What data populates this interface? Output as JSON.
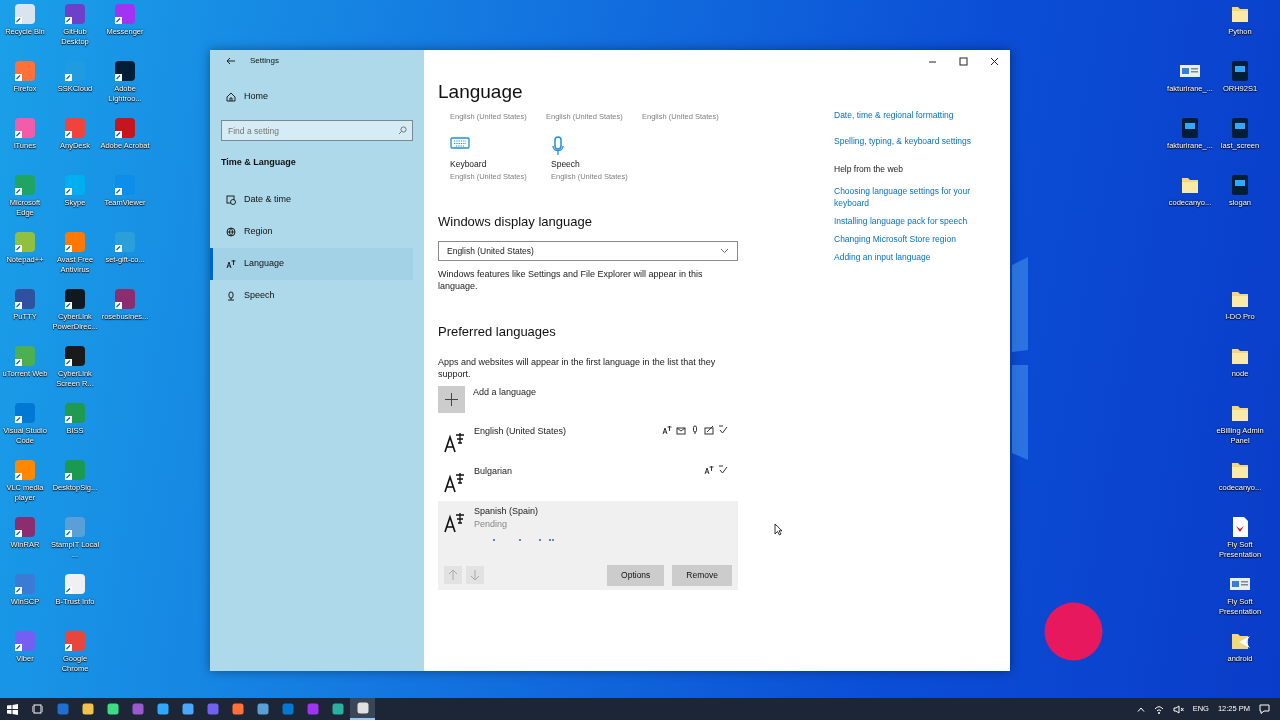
{
  "desktop": {
    "left_columns": [
      [
        {
          "label": "Recycle Bin",
          "color": "#d9e4ee"
        },
        {
          "label": "Firefox",
          "color": "#ff7139"
        },
        {
          "label": "iTunes",
          "color": "#f25ca8"
        },
        {
          "label": "Microsoft Edge",
          "color": "#1fa463"
        },
        {
          "label": "Notepad++",
          "color": "#90c040"
        },
        {
          "label": "PuTTY",
          "color": "#3050a0"
        },
        {
          "label": "uTorrent Web",
          "color": "#4caf50"
        },
        {
          "label": "Visual Studio Code",
          "color": "#0078d4"
        },
        {
          "label": "VLC media player",
          "color": "#ff8800"
        },
        {
          "label": "WinRAR",
          "color": "#8b2d6e"
        },
        {
          "label": "WinSCP",
          "color": "#3a7bd5"
        },
        {
          "label": "Viber",
          "color": "#7360f2"
        }
      ],
      [
        {
          "label": "GitHub Desktop",
          "color": "#6e40c9"
        },
        {
          "label": "SSKCloud",
          "color": "#1f9be0"
        },
        {
          "label": "AnyDesk",
          "color": "#ef443b"
        },
        {
          "label": "Skype",
          "color": "#00aff0"
        },
        {
          "label": "Avast Free Antivirus",
          "color": "#ff7800"
        },
        {
          "label": "CyberLink PowerDirec...",
          "color": "#101820"
        },
        {
          "label": "CyberLink Screen R...",
          "color": "#1a1a1a"
        },
        {
          "label": "BISS",
          "color": "#1f9a4f"
        },
        {
          "label": "DesktopSig...",
          "color": "#1a9a50"
        },
        {
          "label": "StampIT Local ...",
          "color": "#5aa0d8"
        },
        {
          "label": "B-Trust Info",
          "color": "#f0f0f0"
        },
        {
          "label": "Google Chrome",
          "color": "#e8453c"
        }
      ],
      [
        {
          "label": "Messenger",
          "color": "#a034f0"
        },
        {
          "label": "Adobe Lightroo...",
          "color": "#001e36"
        },
        {
          "label": "Adobe Acrobat",
          "color": "#c4161c"
        },
        {
          "label": "TeamViewer",
          "color": "#0e8ee9"
        },
        {
          "label": "set-gift-co...",
          "color": "#2a9fd8"
        },
        {
          "label": "rosebusines...",
          "color": "#8b2d6e"
        }
      ]
    ],
    "right_inner": [
      {
        "label": "fakturirane_...",
        "kind": "document"
      },
      {
        "label": "fakturirane_...",
        "kind": "psd"
      },
      {
        "label": "codecanyo...",
        "kind": "folder"
      }
    ],
    "right_top": [
      {
        "label": "Python",
        "kind": "folder"
      },
      {
        "label": "ORH92S1",
        "kind": "psd"
      },
      {
        "label": "last_screen",
        "kind": "psd"
      },
      {
        "label": "slogan",
        "kind": "psd"
      }
    ],
    "right_bottom": [
      {
        "label": "I-DO Pro",
        "kind": "folder"
      },
      {
        "label": "node",
        "kind": "folder"
      },
      {
        "label": "eBilling Admin Panel",
        "kind": "folder"
      },
      {
        "label": "codecanyo...",
        "kind": "folder"
      },
      {
        "label": "Fly Soft Presentation",
        "kind": "pdf"
      },
      {
        "label": "Fly Soft Presentation",
        "kind": "document"
      },
      {
        "label": "android",
        "kind": "shortcut"
      }
    ]
  },
  "window": {
    "title": "Settings",
    "sidebar": {
      "home": "Home",
      "search": {
        "placeholder": "Find a setting"
      },
      "section": "Time & Language",
      "items": [
        {
          "label": "Date & time",
          "selected": false,
          "kind": "clock"
        },
        {
          "label": "Region",
          "selected": false,
          "kind": "globe"
        },
        {
          "label": "Language",
          "selected": true,
          "kind": "language"
        },
        {
          "label": "Speech",
          "selected": false,
          "kind": "mic"
        }
      ]
    },
    "page_title": "Language",
    "tiles_top": [
      "English (United States)",
      "English (United States)",
      "English (United States)"
    ],
    "tiles": [
      {
        "label": "Keyboard",
        "value": "English (United States)",
        "kind": "keyboard"
      },
      {
        "label": "Speech",
        "value": "English (United States)",
        "kind": "mic"
      }
    ],
    "display_language": {
      "heading": "Windows display language",
      "value": "English (United States)",
      "note": "Windows features like Settings and File Explorer will appear in this language."
    },
    "preferred": {
      "heading": "Preferred languages",
      "note": "Apps and websites will appear in the first language in the list that they support.",
      "add": "Add a language",
      "languages": [
        {
          "name": "English (United States)",
          "selected": false,
          "features": {
            "display": true,
            "keyboard": true,
            "speech": true,
            "handwriting": true,
            "spelling": true
          }
        },
        {
          "name": "Bulgarian",
          "selected": false,
          "features": {
            "display": true,
            "spelling": true
          }
        },
        {
          "name": "Spanish (Spain)",
          "selected": true,
          "status": "Pending"
        }
      ],
      "buttons": [
        {
          "label": "Options"
        },
        {
          "label": "Remove"
        }
      ]
    },
    "related": [
      "Date, time & regional formatting",
      "Spelling, typing, & keyboard settings"
    ],
    "help": {
      "heading": "Help from the web",
      "links": [
        "Choosing language settings for your keyboard",
        "Installing language pack for speech",
        "Changing Microsoft Store region",
        "Adding an input language"
      ]
    }
  },
  "taskbar": {
    "apps": [
      {
        "color": "#1e6fd0",
        "selected": false
      },
      {
        "color": "#f2c14e",
        "selected": false
      },
      {
        "color": "#3ddc84",
        "selected": false
      },
      {
        "color": "#9b59d0",
        "selected": false
      },
      {
        "color": "#31a8ff",
        "selected": false
      },
      {
        "color": "#4aa8ff",
        "selected": false
      },
      {
        "color": "#7360f2",
        "selected": false
      },
      {
        "color": "#ff7139",
        "selected": false
      },
      {
        "color": "#5aa0d8",
        "selected": false
      },
      {
        "color": "#0078d4",
        "selected": false
      },
      {
        "color": "#a034f0",
        "selected": false
      },
      {
        "color": "#2ab0a0",
        "selected": false
      },
      {
        "color": "#e0e0e0",
        "selected": true
      }
    ],
    "language": "ENG",
    "time": "12:25 PM"
  }
}
